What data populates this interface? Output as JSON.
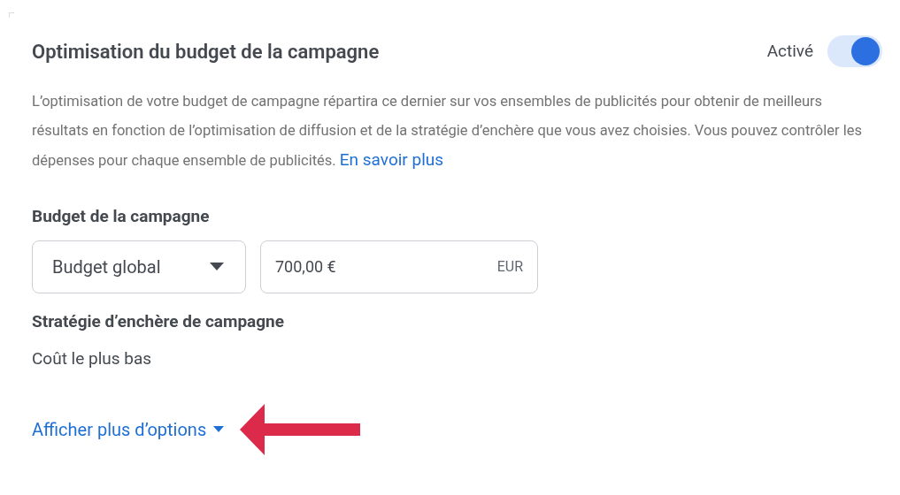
{
  "header": {
    "title": "Optimisation du budget de la campagne",
    "toggle_label": "Activé",
    "toggle_on": true
  },
  "description": {
    "text": "L’optimisation de votre budget de campagne répartira ce dernier sur vos ensembles de publicités pour obtenir de meilleurs résultats en fonction de l’optimisation de diffusion et de la stratégie d’enchère que vous avez choisies. Vous pouvez contrôler les dépenses pour chaque ensemble de publicités.",
    "link": "En savoir plus"
  },
  "budget": {
    "label": "Budget de la campagne",
    "type_select": "Budget global",
    "amount": "700,00 €",
    "currency": "EUR"
  },
  "bid_strategy": {
    "label": "Stratégie d’enchère de campagne",
    "value": "Coût le plus bas"
  },
  "more_options": {
    "label": "Afficher plus d’options",
    "expanded": false
  }
}
